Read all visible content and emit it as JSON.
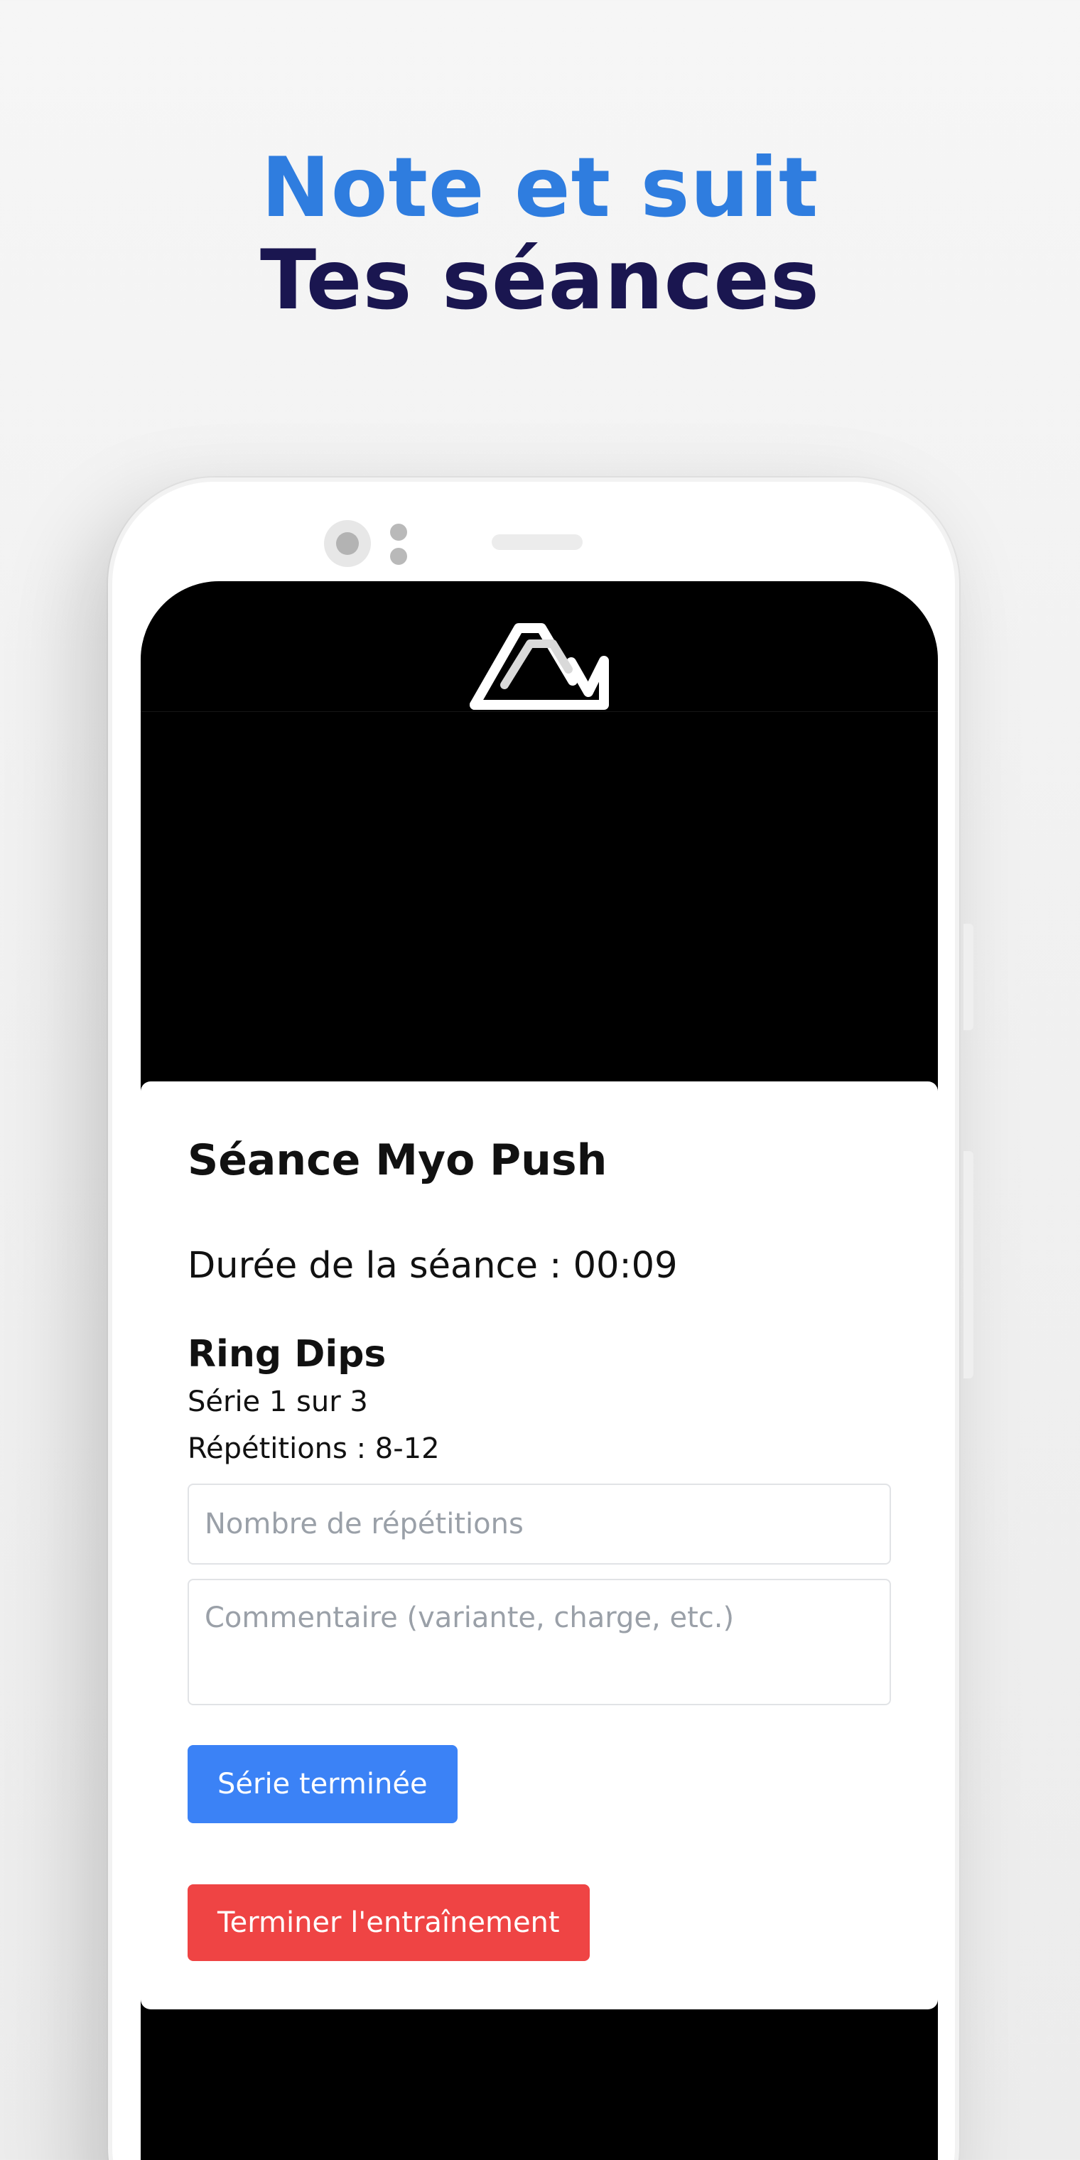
{
  "headline": {
    "line1": "Note et suit",
    "line2": "Tes séances"
  },
  "colors": {
    "headline_accent": "#2f7ddf",
    "headline_dark": "#1a1650",
    "primary_button": "#3b82f6",
    "danger_button": "#ef4444"
  },
  "app": {
    "logo_icon": "brand-mountain-logo"
  },
  "session": {
    "title": "Séance Myo Push",
    "duration_label": "Durée de la séance :",
    "duration_value": "00:09",
    "exercise": {
      "name": "Ring Dips",
      "set_info": "Série 1 sur 3",
      "reps_info": "Répétitions : 8-12"
    },
    "reps_input": {
      "value": "",
      "placeholder": "Nombre de répétitions"
    },
    "comment_input": {
      "value": "",
      "placeholder": "Commentaire (variante, charge, etc.)"
    },
    "set_done_label": "Série terminée",
    "finish_label": "Terminer l'entraînement"
  }
}
